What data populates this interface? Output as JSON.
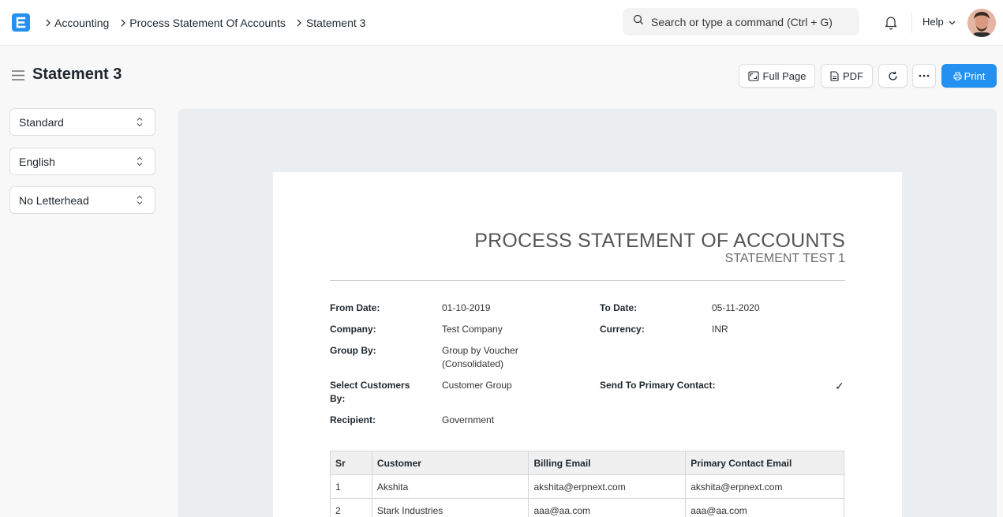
{
  "breadcrumbs": [
    "Accounting",
    "Process Statement Of Accounts",
    "Statement 3"
  ],
  "search": {
    "placeholder": "Search or type a command (Ctrl + G)"
  },
  "nav": {
    "help_label": "Help"
  },
  "page": {
    "title": "Statement 3"
  },
  "toolbar": {
    "full_page_label": "Full Page",
    "pdf_label": "PDF",
    "print_label": "Print"
  },
  "sidebar": {
    "print_format": "Standard",
    "language": "English",
    "letterhead": "No Letterhead"
  },
  "document": {
    "title": "PROCESS STATEMENT OF ACCOUNTS",
    "subtitle": "STATEMENT TEST 1",
    "fields": {
      "from_date": {
        "label": "From Date:",
        "value": "01-10-2019"
      },
      "to_date": {
        "label": "To Date:",
        "value": "05-11-2020"
      },
      "company": {
        "label": "Company:",
        "value": "Test Company"
      },
      "currency": {
        "label": "Currency:",
        "value": "INR"
      },
      "group_by": {
        "label": "Group By:",
        "value_line1": "Group by Voucher",
        "value_line2": "(Consolidated)"
      },
      "select_customers": {
        "label_line1": "Select Customers",
        "label_line2": "By:",
        "value": "Customer Group"
      },
      "send_primary": {
        "label": "Send To Primary Contact:",
        "value": "✓"
      },
      "recipient": {
        "label": "Recipient:",
        "value": "Government"
      }
    },
    "table": {
      "headers": [
        "Sr",
        "Customer",
        "Billing Email",
        "Primary Contact Email"
      ],
      "rows": [
        [
          "1",
          "Akshita",
          "akshita@erpnext.com",
          "akshita@erpnext.com"
        ],
        [
          "2",
          "Stark Industries",
          "aaa@aa.com",
          "aaa@aa.com"
        ]
      ]
    }
  },
  "colors": {
    "primary": "#2490ef",
    "text": "#1f272e",
    "preview_bg": "#ebeef0"
  }
}
